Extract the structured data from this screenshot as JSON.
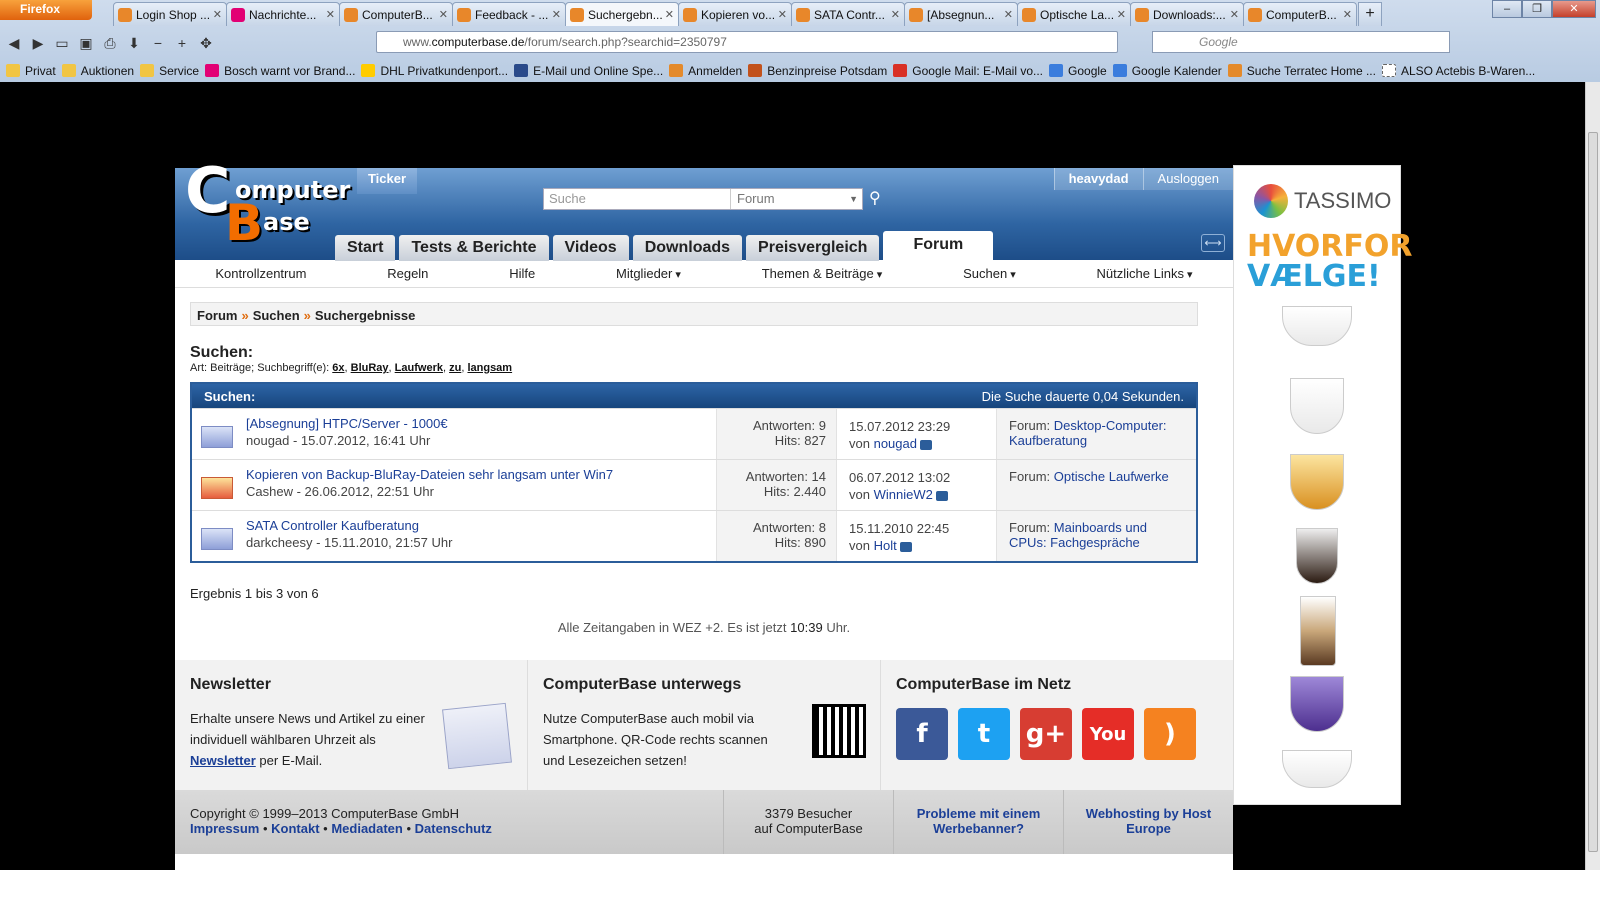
{
  "browser": {
    "menu_button": "Firefox",
    "tabs": [
      {
        "title": "Login Shop ..."
      },
      {
        "title": "Nachrichte..."
      },
      {
        "title": "ComputerB..."
      },
      {
        "title": "Feedback - ..."
      },
      {
        "title": "Suchergebn...",
        "active": true
      },
      {
        "title": "Kopieren vo..."
      },
      {
        "title": "SATA Contr..."
      },
      {
        "title": "[Absegnun..."
      },
      {
        "title": "Optische La..."
      },
      {
        "title": "Downloads:..."
      },
      {
        "title": "ComputerB..."
      }
    ],
    "url_prefix": "www.",
    "url_domain": "computerbase.de",
    "url_path": "/forum/search.php?searchid=2350797",
    "search_engine_placeholder": "Google",
    "bookmarks": [
      "Privat",
      "Auktionen",
      "Service",
      "Bosch warnt vor Brand...",
      "DHL Privatkundenport...",
      "E-Mail und Online Spe...",
      "Anmelden",
      "Benzinpreise Potsdam",
      "Google Mail: E-Mail vo...",
      "Google",
      "Google Kalender",
      "Suche Terratec Home ...",
      "ALSO Actebis B-Waren..."
    ]
  },
  "site": {
    "logo_c": "C",
    "logo_omputer": "omputer",
    "logo_b": "B",
    "logo_ase": "ase",
    "ticker": "Ticker",
    "search_placeholder": "Suche",
    "search_scope": "Forum",
    "user": "heavydad",
    "logout": "Ausloggen",
    "main_tabs": [
      "Start",
      "Tests & Berichte",
      "Videos",
      "Downloads",
      "Preisvergleich",
      "Forum"
    ],
    "subnav": [
      "Kontrollzentrum",
      "Regeln",
      "Hilfe",
      "Mitglieder",
      "Themen & Beiträge",
      "Suchen",
      "Nützliche Links"
    ],
    "breadcrumb": [
      "Forum",
      "Suchen",
      "Suchergebnisse"
    ],
    "breadcrumb_sep": "»",
    "search_heading": "Suchen:",
    "search_info_prefix": "Art: Beiträge; Suchbegriff(e):",
    "search_terms": [
      "6x",
      "BluRay",
      "Laufwerk",
      "zu",
      "langsam"
    ],
    "results_header": "Suchen:",
    "results_duration": "Die Suche dauerte 0,04 Sekunden.",
    "results": [
      {
        "title": "[Absegnung] HTPC/Server - 1000€",
        "meta": "nougad - 15.07.2012, 16:41 Uhr",
        "answers": "Antworten: 9",
        "hits": "Hits: 827",
        "last_date": "15.07.2012 23:29",
        "last_by_prefix": "von",
        "last_user": "nougad",
        "forum_prefix": "Forum:",
        "forum": "Desktop-Computer: Kaufberatung",
        "hot": false
      },
      {
        "title": "Kopieren von Backup-BluRay-Dateien sehr langsam unter Win7",
        "meta": "Cashew - 26.06.2012, 22:51 Uhr",
        "answers": "Antworten: 14",
        "hits": "Hits: 2.440",
        "last_date": "06.07.2012 13:02",
        "last_by_prefix": "von",
        "last_user": "WinnieW2",
        "forum_prefix": "Forum:",
        "forum": "Optische Laufwerke",
        "hot": true
      },
      {
        "title": "SATA Controller Kaufberatung",
        "meta": "darkcheesy - 15.11.2010, 21:57 Uhr",
        "answers": "Antworten: 8",
        "hits": "Hits: 890",
        "last_date": "15.11.2010 22:45",
        "last_by_prefix": "von",
        "last_user": "Holt",
        "forum_prefix": "Forum:",
        "forum": "Mainboards und CPUs: Fachgespräche",
        "hot": false
      }
    ],
    "result_count": "Ergebnis 1 bis 3 von 6",
    "timezone_prefix": "Alle Zeitangaben in WEZ +2. Es ist jetzt",
    "timezone_time": "10:39",
    "timezone_suffix": "Uhr.",
    "footer": {
      "newsletter_title": "Newsletter",
      "newsletter_text_1": "Erhalte unsere News und Artikel zu einer individuell wählbaren Uhrzeit als",
      "newsletter_link": "Newsletter",
      "newsletter_text_2": "per E-Mail.",
      "mobile_title": "ComputerBase unterwegs",
      "mobile_text": "Nutze ComputerBase auch mobil via Smartphone. QR-Code rechts scannen und Lesezeichen setzen!",
      "social_title": "ComputerBase im Netz",
      "social": [
        {
          "name": "facebook-icon",
          "glyph": "f",
          "color": "#3b5998"
        },
        {
          "name": "twitter-icon",
          "glyph": "t",
          "color": "#1da1f2"
        },
        {
          "name": "google-plus-icon",
          "glyph": "g+",
          "color": "#d73d32"
        },
        {
          "name": "youtube-icon",
          "glyph": "You",
          "color": "#e52d27"
        },
        {
          "name": "rss-icon",
          "glyph": ")",
          "color": "#f58220"
        }
      ]
    },
    "copyright": "Copyright © 1999–2013 ComputerBase GmbH",
    "copyright_links": [
      "Impressum",
      "Kontakt",
      "Mediadaten",
      "Datenschutz"
    ],
    "visitors_1": "3379 Besucher",
    "visitors_2": "auf ComputerBase",
    "banner_problem": "Probleme mit einem Werbebanner?",
    "hosting": "Webhosting by Host Europe"
  },
  "ad": {
    "brand": "TASSIMO",
    "slogan_1": "HVORFOR",
    "slogan_2": "VÆLGE!"
  }
}
